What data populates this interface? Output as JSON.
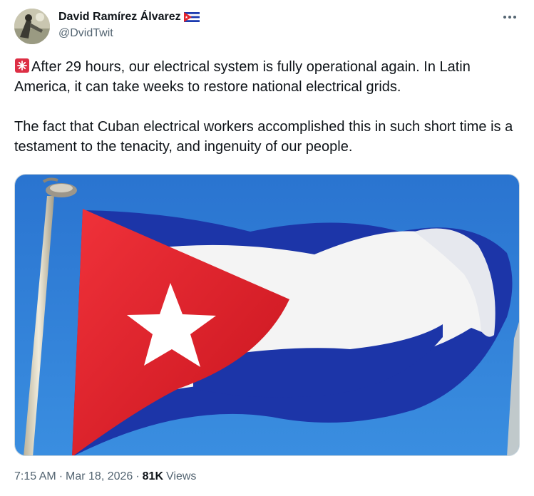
{
  "author": {
    "display_name": "David Ramírez Álvarez",
    "handle": "@DvidTwit",
    "flag_icon": "cuba-flag-emoji",
    "avatar_icon": "profile-photo"
  },
  "more_icon": "ellipsis-icon",
  "tweet": {
    "paragraph_1": "After 29 hours, our electrical system is fully operational again. In Latin America, it can take weeks to restore national electrical grids.",
    "paragraph_2": "The fact that Cuban electrical workers accomplished this in such short time is a testament to the tenacity, and ingenuity of our people.",
    "lead_icon": "rotating-light-emoji"
  },
  "media": {
    "subject": "cuban-flag-photo",
    "colors": {
      "sky": "#2f7fd6",
      "blue_stripe": "#1c35a8",
      "red": "#e3232c",
      "white": "#f4f4f4"
    }
  },
  "meta": {
    "time": "7:15 AM",
    "separator": "·",
    "date": "Mar 18, 2026",
    "views_count": "81K",
    "views_label": "Views"
  }
}
